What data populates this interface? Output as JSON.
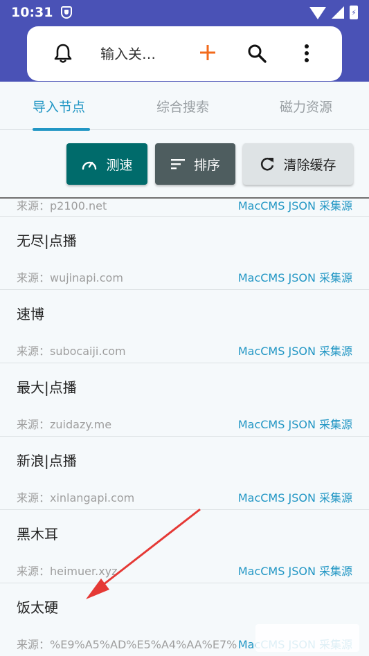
{
  "status": {
    "time": "10:31"
  },
  "search": {
    "text": "输入关…"
  },
  "tabs": [
    {
      "label": "导入节点"
    },
    {
      "label": "综合搜索"
    },
    {
      "label": "磁力资源"
    }
  ],
  "buttons": {
    "speed": "测速",
    "sort": "排序",
    "clear": "清除缓存"
  },
  "partial_row": {
    "source": "来源：p2100.net",
    "type": "MacCMS JSON 采集源"
  },
  "rows": [
    {
      "name": "无尽|点播",
      "source": "来源：wujinapi.com",
      "type": "MacCMS JSON 采集源"
    },
    {
      "name": "速博",
      "source": "来源：subocaiji.com",
      "type": "MacCMS JSON 采集源"
    },
    {
      "name": "最大|点播",
      "source": "来源：zuidazy.me",
      "type": "MacCMS JSON 采集源"
    },
    {
      "name": "新浪|点播",
      "source": "来源：xinlangapi.com",
      "type": "MacCMS JSON 采集源"
    },
    {
      "name": "黑木耳",
      "source": "来源：heimuer.xyz",
      "type": "MacCMS JSON 采集源"
    },
    {
      "name": "饭太硬",
      "source": "来源：%E9%A5%AD%E5%A4%AA%E7%",
      "type": "MacCMS JSON 采集源"
    }
  ],
  "colors": {
    "header": "#4a52b6",
    "accent": "#2196c4",
    "speed_button": "#006b6b",
    "sort_button": "#4e5d5f",
    "clear_button": "#dee3e5",
    "plus": "#f26a1b",
    "arrow": "#e53935"
  }
}
